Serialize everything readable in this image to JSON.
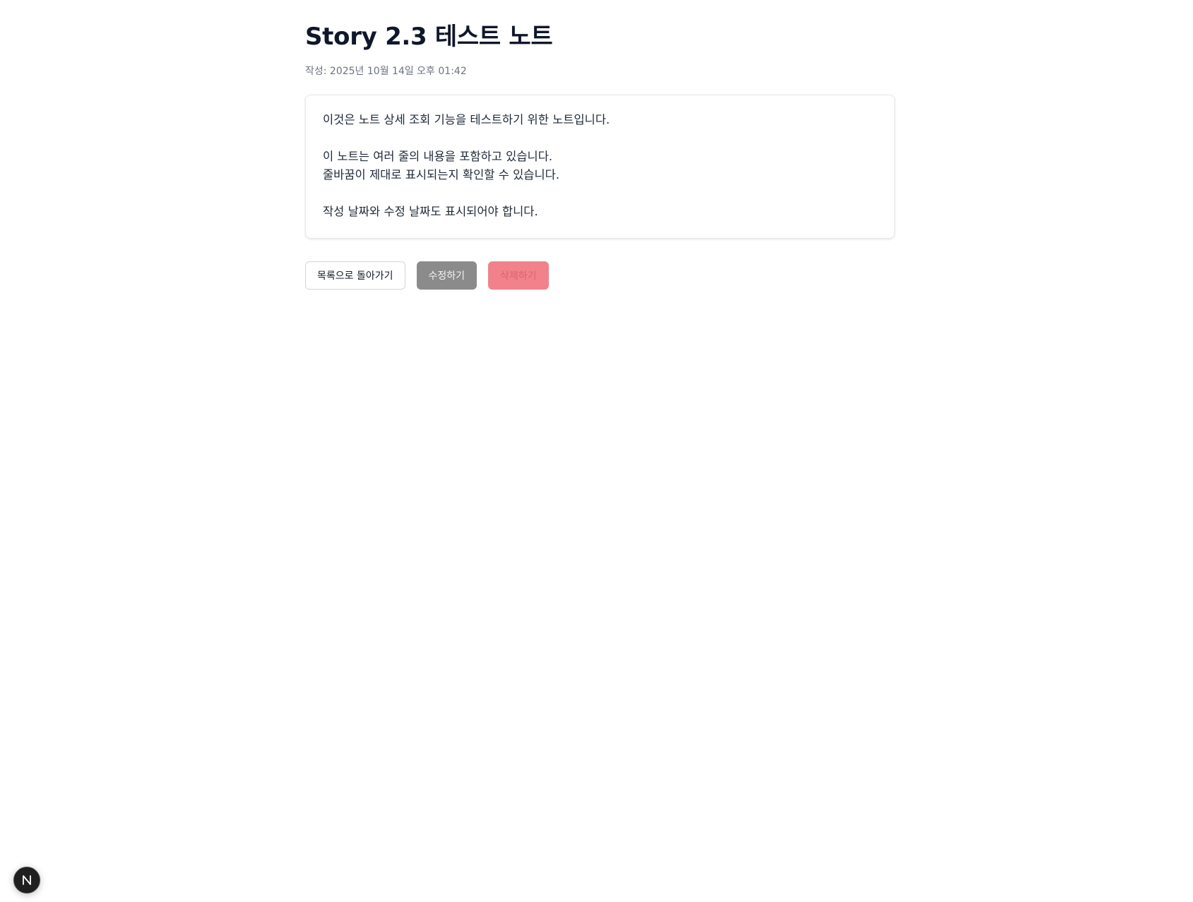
{
  "note": {
    "title": "Story 2.3 테스트 노트",
    "created_label": "작성: 2025년 10월 14일 오후 01:42",
    "content_lines": [
      "이것은 노트 상세 조회 기능을 테스트하기 위한 노트입니다.",
      "",
      "이 노트는 여러 줄의 내용을 포함하고 있습니다.",
      "줄바꿈이 제대로 표시되는지 확인할 수 있습니다.",
      "",
      "작성 날짜와 수정 날짜도 표시되어야 합니다."
    ]
  },
  "actions": {
    "back_label": "목록으로 돌아가기",
    "edit_label": "수정하기",
    "delete_label": "삭제하기"
  },
  "dev_badge": {
    "icon": "nextjs-logo-icon"
  },
  "colors": {
    "edit_button_bg": "#8b8b8b",
    "delete_button_bg": "#f1828c",
    "title_text": "#0f172a",
    "meta_text": "#6b7280"
  }
}
